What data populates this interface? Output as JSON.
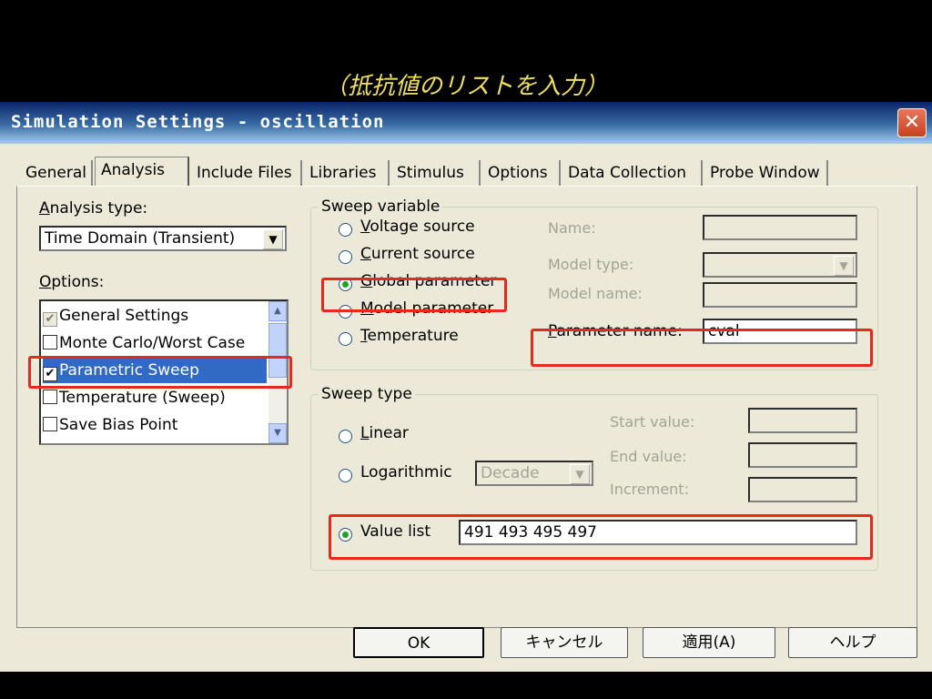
{
  "caption": "（抵抗値のリストを入力）",
  "window": {
    "title": "Simulation Settings - oscillation",
    "close_label": "✕"
  },
  "tabs": [
    "General",
    "Analysis",
    "Include Files",
    "Libraries",
    "Stimulus",
    "Options",
    "Data Collection",
    "Probe Window"
  ],
  "active_tab": "Analysis",
  "analysis_type": {
    "label_key": "A",
    "label_rest": "nalysis type:",
    "value": "Time Domain (Transient)"
  },
  "options": {
    "label_key": "O",
    "label_rest": "ptions:",
    "items": [
      {
        "label": "General Settings",
        "checked": true,
        "grayed": true
      },
      {
        "label": "Monte Carlo/Worst Case",
        "checked": false
      },
      {
        "label": "Parametric Sweep",
        "checked": true,
        "selected": true
      },
      {
        "label": "Temperature (Sweep)",
        "checked": false
      },
      {
        "label": "Save Bias Point",
        "checked": false
      }
    ]
  },
  "sweep_variable": {
    "legend": "Sweep variable",
    "options": [
      {
        "key": "V",
        "rest": "oltage source",
        "selected": false
      },
      {
        "key": "C",
        "rest": "urrent source",
        "selected": false
      },
      {
        "key": "G",
        "rest": "lobal parameter",
        "selected": true
      },
      {
        "key": "M",
        "rest": "odel parameter",
        "selected": false
      },
      {
        "key": "T",
        "rest": "emperature",
        "selected": false
      }
    ],
    "name_label": "Name:",
    "model_type_label": "Model type:",
    "model_name_label": "Model name:",
    "parameter_name_label_key": "P",
    "parameter_name_label_rest": "arameter name:",
    "parameter_name_value": "cval"
  },
  "sweep_type": {
    "legend": "Sweep type",
    "linear_key": "L",
    "linear_rest": "inear",
    "logarithmic_label": "Logarithmic",
    "log_scale_value": "Decade",
    "start_label": "Start value:",
    "end_label": "End value:",
    "increment_label": "Increment:",
    "value_list_label": "Value list",
    "value_list_value": "491 493 495 497",
    "selected": "value_list"
  },
  "buttons": {
    "ok": "OK",
    "cancel": "キャンセル",
    "apply": "適用(A)",
    "help": "ヘルプ"
  },
  "colors": {
    "highlight": "#e8281c",
    "title_bar": "#0a246a",
    "selection": "#316ac5"
  }
}
